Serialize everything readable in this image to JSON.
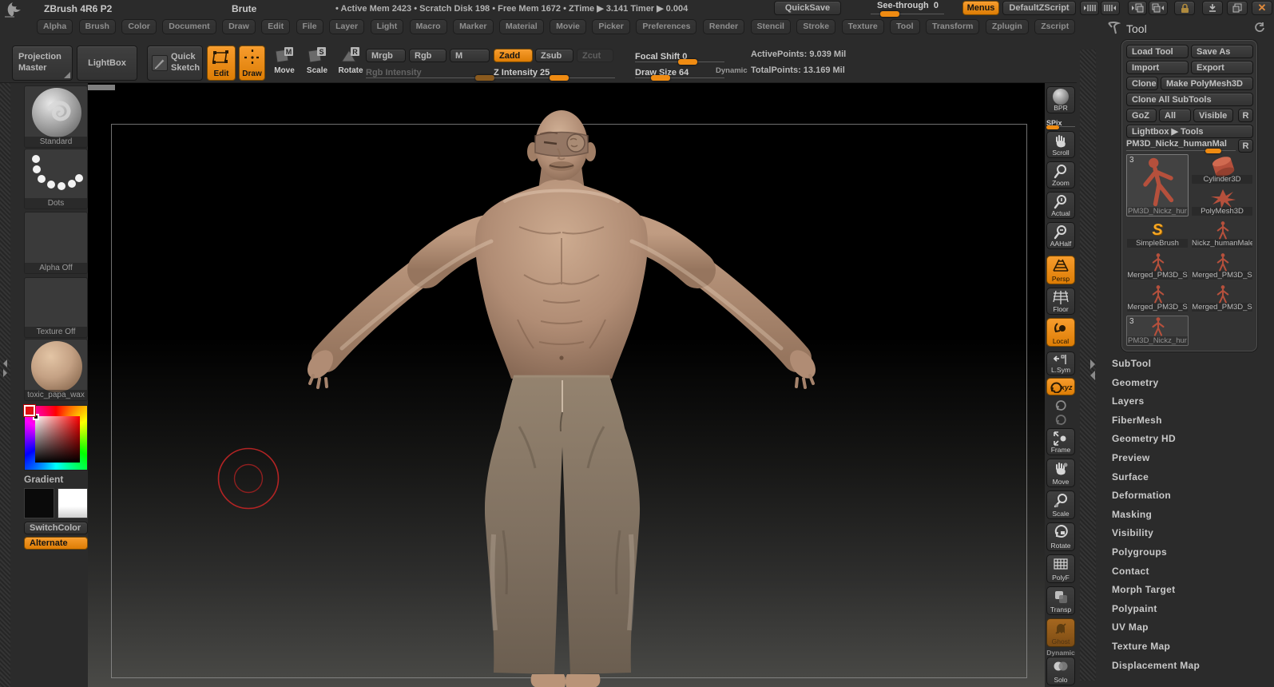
{
  "colors": {
    "accent": "#ef8b12",
    "cursor_red": "#b32424",
    "skin": "#b08c74",
    "pants": "#84746a",
    "thumb_red": "#b5503c",
    "canvas_top": "#000000",
    "canvas_bottom": "#4a4a47"
  },
  "titlebar": {
    "app_title": "ZBrush 4R6 P2",
    "doc_title": "Brute",
    "session_stats": "• Active Mem 2423 • Scratch Disk 198 • Free Mem 1672 • ZTime ▶ 3.141  Timer ▶ 0.004",
    "quicksave_label": "QuickSave",
    "see_through_label": "See-through",
    "see_through_value": "0",
    "menus_label": "Menus",
    "default_zscript_label": "DefaultZScript"
  },
  "menubar": {
    "items": [
      "Alpha",
      "Brush",
      "Color",
      "Document",
      "Draw",
      "Edit",
      "File",
      "Layer",
      "Light",
      "Macro",
      "Marker",
      "Material",
      "Movie",
      "Picker",
      "Preferences",
      "Render",
      "Stencil",
      "Stroke",
      "Texture",
      "Tool",
      "Transform",
      "Zplugin",
      "Zscript"
    ]
  },
  "shelf": {
    "projection_master": "Projection Master",
    "lightbox": "LightBox",
    "quick_sketch": "Quick Sketch",
    "edit": "Edit",
    "draw": "Draw",
    "move": "Move",
    "scale": "Scale",
    "rotate": "Rotate",
    "mrgb": "Mrgb",
    "rgb": "Rgb",
    "m": "M",
    "zadd": "Zadd",
    "zsub": "Zsub",
    "zcut": "Zcut",
    "rgb_intensity": "Rgb Intensity",
    "z_intensity": "Z Intensity 25",
    "focal_shift": "Focal Shift 0",
    "draw_size": "Draw Size 64",
    "dynamic": "Dynamic",
    "active_points": "ActivePoints: 9.039 Mil",
    "total_points": "TotalPoints: 13.169 Mil"
  },
  "left_tray": {
    "brush_name": "Standard",
    "stroke_name": "Dots",
    "alpha_label": "Alpha Off",
    "texture_label": "Texture Off",
    "material_name": "toxic_papa_wax",
    "gradient_label": "Gradient",
    "switch_color_label": "SwitchColor",
    "alternate_label": "Alternate"
  },
  "right_shelf": {
    "bpr": "BPR",
    "spix": "SPix",
    "scroll": "Scroll",
    "zoom": "Zoom",
    "actual": "Actual",
    "aahalf": "AAHalf",
    "persp": "Persp",
    "floor": "Floor",
    "local": "Local",
    "lsym": "L.Sym",
    "xyz": "xyz",
    "frame": "Frame",
    "move": "Move",
    "scale": "Scale",
    "rotate": "Rotate",
    "polyf": "PolyF",
    "transp": "Transp",
    "ghost": "Ghost",
    "dynamic": "Dynamic",
    "solo": "Solo"
  },
  "tool_panel": {
    "title": "Tool",
    "buttons": {
      "load_tool": "Load Tool",
      "save_as": "Save As",
      "import": "Import",
      "export": "Export",
      "clone": "Clone",
      "make_polymesh3d": "Make PolyMesh3D",
      "clone_all_subtools": "Clone All SubTools",
      "goz": "GoZ",
      "all": "All",
      "visible": "Visible",
      "r": "R"
    },
    "lightbox_tools": "Lightbox ▶ Tools",
    "current_tool": {
      "name": "PM3D_Nickz_humanMal",
      "r": "R"
    },
    "thumbnails": [
      {
        "label": "PM3D_Nickz_hur",
        "badge": "3"
      },
      {
        "label": "Cylinder3D"
      },
      {
        "label": "PolyMesh3D"
      },
      {
        "label": "SimpleBrush"
      },
      {
        "label": "Nickz_humanMale"
      },
      {
        "label": "Merged_PM3D_S"
      },
      {
        "label": "Merged_PM3D_S"
      },
      {
        "label": "Merged_PM3D_S"
      },
      {
        "label": "Merged_PM3D_S"
      },
      {
        "label": "PM3D_Nickz_hur",
        "badge": "3"
      }
    ],
    "sections": [
      "SubTool",
      "Geometry",
      "Layers",
      "FiberMesh",
      "Geometry HD",
      "Preview",
      "Surface",
      "Deformation",
      "Masking",
      "Visibility",
      "Polygroups",
      "Contact",
      "Morph Target",
      "Polypaint",
      "UV Map",
      "Texture Map",
      "Displacement Map"
    ]
  }
}
